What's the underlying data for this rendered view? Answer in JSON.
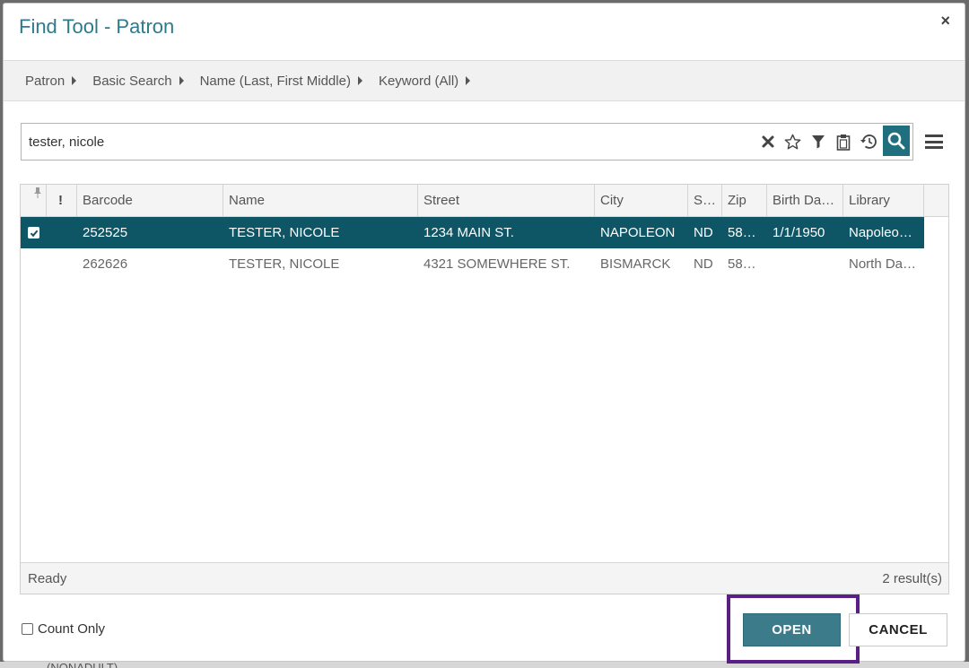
{
  "dialog": {
    "title": "Find Tool - Patron",
    "close_glyph": "×"
  },
  "breadcrumb": [
    {
      "label": "Patron"
    },
    {
      "label": "Basic Search"
    },
    {
      "label": "Name (Last, First Middle)"
    },
    {
      "label": "Keyword (All)"
    }
  ],
  "search": {
    "value": "tester, nicole",
    "icons": [
      "clear-icon",
      "star-icon",
      "filter-icon",
      "clipboard-icon",
      "history-icon",
      "search-icon"
    ]
  },
  "grid": {
    "columns": [
      {
        "key": "pin",
        "label": ""
      },
      {
        "key": "flag",
        "label": "!"
      },
      {
        "key": "barcode",
        "label": "Barcode"
      },
      {
        "key": "name",
        "label": "Name"
      },
      {
        "key": "street",
        "label": "Street"
      },
      {
        "key": "city",
        "label": "City"
      },
      {
        "key": "state",
        "label": "S…"
      },
      {
        "key": "zip",
        "label": "Zip"
      },
      {
        "key": "birth",
        "label": "Birth Da…"
      },
      {
        "key": "library",
        "label": "Library"
      }
    ],
    "rows": [
      {
        "selected": true,
        "barcode": "252525",
        "name": "TESTER, NICOLE",
        "street": "1234 MAIN ST.",
        "city": "NAPOLEON",
        "state": "ND",
        "zip": "58…",
        "birth": "1/1/1950",
        "library": "Napoleo…"
      },
      {
        "selected": false,
        "barcode": "262626",
        "name": "TESTER, NICOLE",
        "street": "4321 SOMEWHERE ST.",
        "city": "BISMARCK",
        "state": "ND",
        "zip": "58…",
        "birth": "",
        "library": "North Da…"
      }
    ],
    "status": "Ready",
    "result_count": "2 result(s)"
  },
  "footer": {
    "count_only_label": "Count Only",
    "open_label": "OPEN",
    "cancel_label": "CANCEL"
  },
  "background": {
    "partial_text": "(NONADULT)"
  },
  "colors": {
    "title": "#2c7a8c",
    "selected_row": "#0e5566",
    "open_button": "#3b7b8a",
    "highlight": "#5a1f86"
  }
}
